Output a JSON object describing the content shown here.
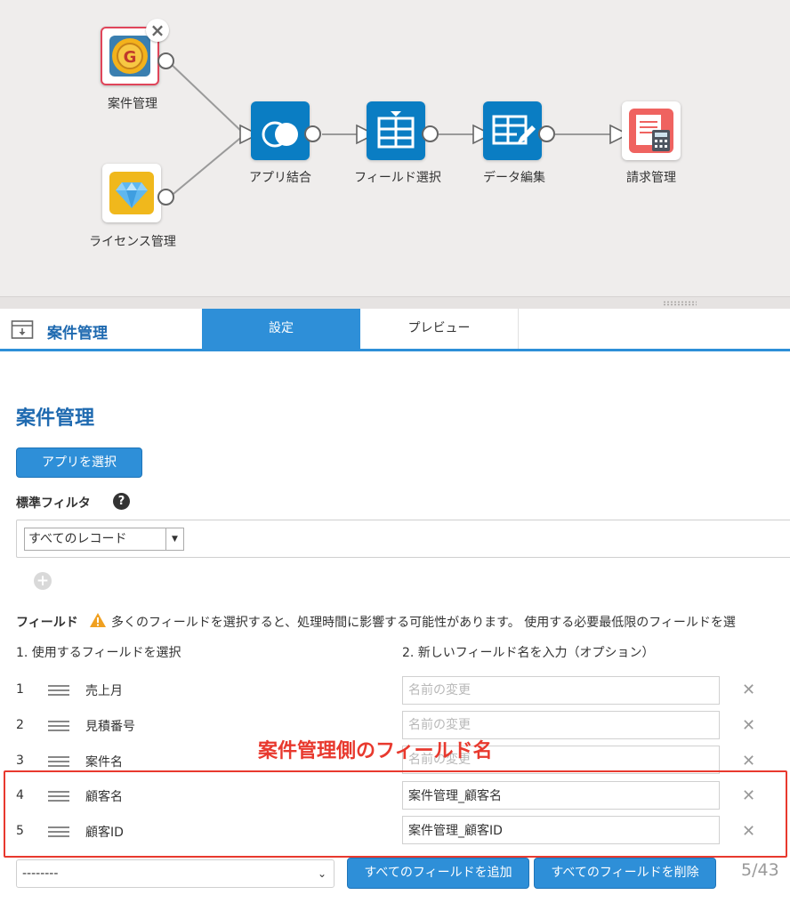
{
  "flow": {
    "nodes": {
      "source1_label": "案件管理",
      "source2_label": "ライセンス管理",
      "join_label": "アプリ結合",
      "field_select_label": "フィールド選択",
      "data_edit_label": "データ編集",
      "output_label": "請求管理"
    }
  },
  "panel": {
    "title": "案件管理",
    "tabs": [
      {
        "label": "設定",
        "active": true
      },
      {
        "label": "プレビュー",
        "active": false
      }
    ]
  },
  "settings": {
    "heading": "案件管理",
    "select_app_button": "アプリを選択",
    "standard_filter_label": "標準フィルタ",
    "help_symbol": "?",
    "filter_value": "すべてのレコード",
    "fields_label": "フィールド",
    "fields_warning": "多くのフィールドを選択すると、処理時間に影響する可能性があります。 使用する必要最低限のフィールドを選",
    "col1_header": "1. 使用するフィールドを選択",
    "col2_header": "2. 新しいフィールド名を入力（オプション）",
    "rename_placeholder": "名前の変更",
    "rows": [
      {
        "num": "1",
        "name": "売上月",
        "new_name": ""
      },
      {
        "num": "2",
        "name": "見積番号",
        "new_name": ""
      },
      {
        "num": "3",
        "name": "案件名",
        "new_name": ""
      },
      {
        "num": "4",
        "name": "顧客名",
        "new_name": "案件管理_顧客名"
      },
      {
        "num": "5",
        "name": "顧客ID",
        "new_name": "案件管理_顧客ID"
      }
    ],
    "delete_symbol": "✕",
    "field_select_value": "--------",
    "add_all_button": "すべてのフィールドを追加",
    "remove_all_button": "すべてのフィールドを削除",
    "counter": "5/43"
  },
  "annotation": {
    "text": "案件管理側のフィールド名"
  },
  "colors": {
    "accent": "#2e8fd8",
    "highlight": "#e8392e",
    "operator_node": "#0a7dc3"
  }
}
